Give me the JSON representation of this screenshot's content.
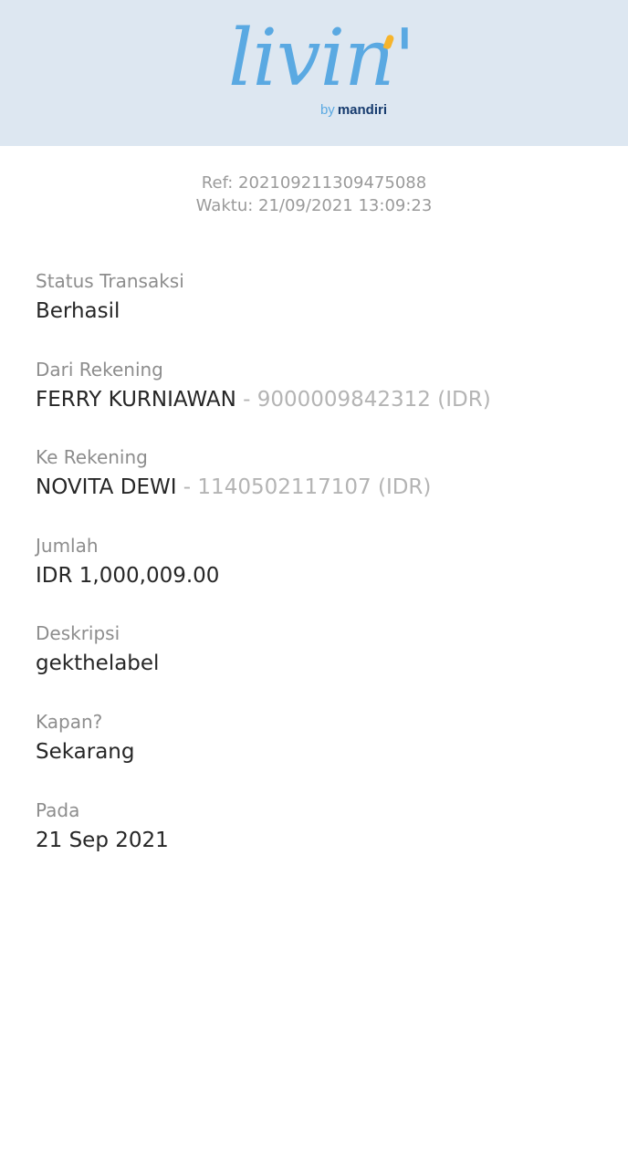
{
  "header": {
    "logo_text": "livin'",
    "logo_by": "by",
    "logo_brand": "mandiri"
  },
  "meta": {
    "ref": "Ref: 202109211309475088",
    "time": "Waktu: 21/09/2021 13:09:23"
  },
  "fields": {
    "status": {
      "label": "Status Transaksi",
      "value": "Berhasil"
    },
    "from": {
      "label": "Dari Rekening",
      "name": "FERRY KURNIAWAN",
      "separator": " - ",
      "account": "9000009842312 (IDR)"
    },
    "to": {
      "label": "Ke Rekening",
      "name": "NOVITA DEWI",
      "separator": " - ",
      "account": "1140502117107 (IDR)"
    },
    "amount": {
      "label": "Jumlah",
      "value": "IDR 1,000,009.00"
    },
    "description": {
      "label": "Deskripsi",
      "value": "gekthelabel"
    },
    "when": {
      "label": "Kapan?",
      "value": "Sekarang"
    },
    "date": {
      "label": "Pada",
      "value": "21 Sep 2021"
    }
  },
  "colors": {
    "header_bg": "#dde7f1",
    "logo_blue": "#5aa9e2",
    "logo_accent": "#f6b42b",
    "brand_navy": "#163b6e"
  }
}
